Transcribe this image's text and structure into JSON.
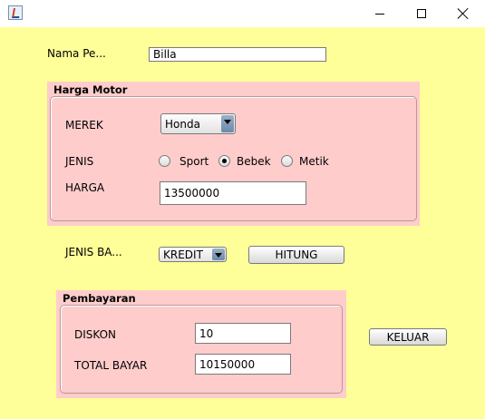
{
  "window": {
    "icon": "java-icon",
    "controls": [
      "minimize-icon",
      "maximize-icon",
      "close-icon"
    ]
  },
  "nama": {
    "label": "Nama Pe...",
    "value": "Billa"
  },
  "harga_motor": {
    "title": "Harga Motor",
    "merek_label": "MEREK",
    "merek_value": "Honda",
    "jenis_label": "JENIS",
    "jenis_options": [
      "Sport",
      "Bebek",
      "Metik"
    ],
    "jenis_selected": "Bebek",
    "harga_label": "HARGA",
    "harga_value": "13500000"
  },
  "jenis_bayar": {
    "label": "JENIS BA...",
    "value": "KREDIT"
  },
  "hitung_button": "HITUNG",
  "pembayaran": {
    "title": "Pembayaran",
    "diskon_label": "DISKON",
    "diskon_value": "10",
    "total_label": "TOTAL BAYAR",
    "total_value": "10150000"
  },
  "keluar_button": "KELUAR",
  "colors": {
    "background": "#ffff99",
    "panel": "#ffcccc"
  }
}
